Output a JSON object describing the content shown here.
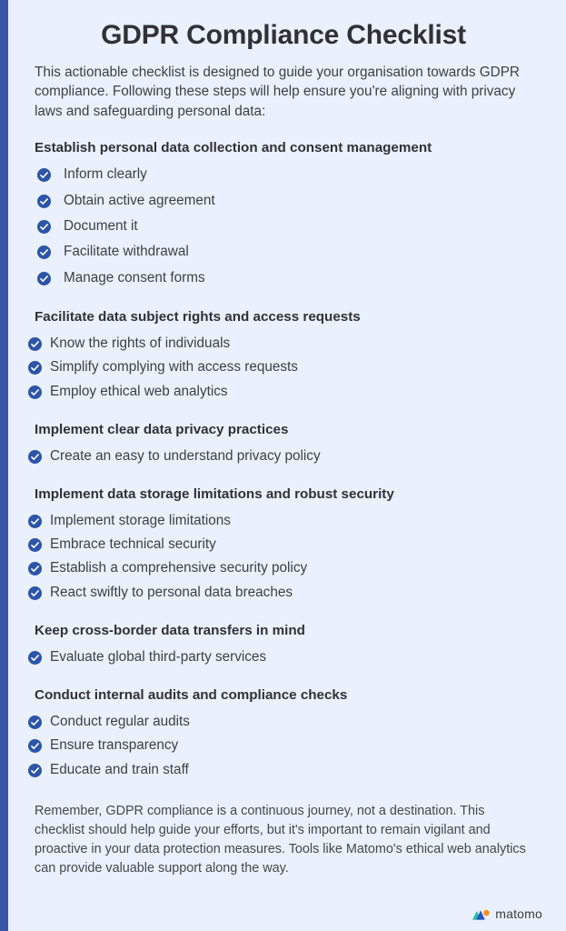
{
  "title": "GDPR Compliance Checklist",
  "intro": "This actionable checklist is designed to guide your organisation towards GDPR compliance. Following these steps will help ensure you're aligning with privacy laws and safeguarding personal data:",
  "colors": {
    "background": "#eaf0fd",
    "left_border": "#3a55a5",
    "check_icon": "#2c54a8",
    "heading_text": "#2f3136",
    "body_text": "#3d4045",
    "brand_teal": "#23bda0",
    "brand_blue": "#2a55c0",
    "brand_orange": "#f6921e"
  },
  "sections": [
    {
      "heading": "Establish personal data collection and consent management",
      "items": [
        "Inform clearly",
        "Obtain active agreement",
        "Document it",
        "Facilitate withdrawal",
        "Manage consent forms"
      ]
    },
    {
      "heading": "Facilitate data subject rights and access requests",
      "items": [
        "Know the rights of individuals",
        "Simplify complying with access requests",
        "Employ ethical web analytics"
      ]
    },
    {
      "heading": "Implement clear data privacy practices",
      "items": [
        "Create an easy to understand privacy policy"
      ]
    },
    {
      "heading": "Implement data storage limitations and robust security",
      "items": [
        "Implement storage limitations",
        "Embrace technical security",
        "Establish a comprehensive security policy",
        "React swiftly to personal data breaches"
      ]
    },
    {
      "heading": "Keep cross-border data transfers in mind",
      "items": [
        "Evaluate global third-party services"
      ]
    },
    {
      "heading": "Conduct internal audits and compliance checks",
      "items": [
        "Conduct regular audits",
        "Ensure transparency",
        "Educate and train staff"
      ]
    }
  ],
  "outro": "Remember, GDPR compliance is a continuous journey, not a destination. This checklist should help guide your efforts, but it's important to remain vigilant and proactive in your data protection measures. Tools like Matomo's ethical web analytics can provide valuable support along the way.",
  "brand": {
    "name": "matomo",
    "mark": "matomo-logo-icon"
  }
}
